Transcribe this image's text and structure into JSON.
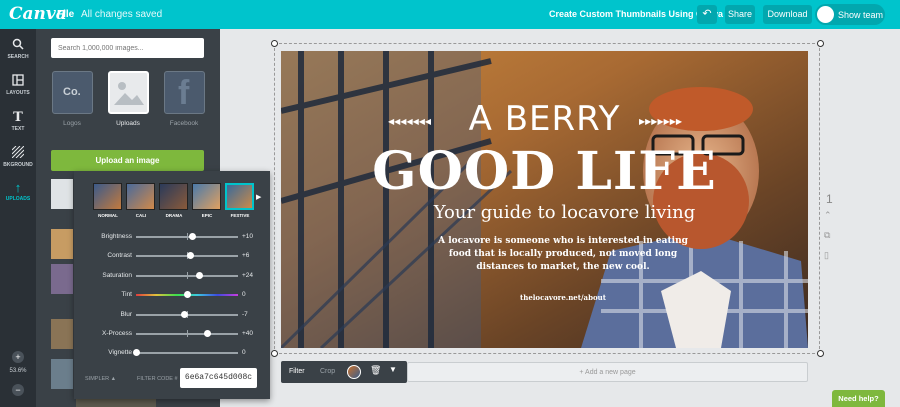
{
  "topbar": {
    "logo": "Canva",
    "file_menu": "File",
    "save_status": "All changes saved",
    "document_title": "Create Custom Thumbnails Using Canva",
    "undo_icon": "undo-icon",
    "share_label": "Share",
    "download_label": "Download",
    "team_label": "Show team"
  },
  "rail": {
    "items": [
      {
        "label": "SEARCH",
        "icon": "search-icon"
      },
      {
        "label": "LAYOUTS",
        "icon": "layouts-icon"
      },
      {
        "label": "TEXT",
        "icon": "text-icon"
      },
      {
        "label": "BKGROUND",
        "icon": "background-icon"
      },
      {
        "label": "UPLOADS",
        "icon": "upload-icon"
      }
    ],
    "zoom_in": "+",
    "zoom_level": "53.6%",
    "zoom_out": "−"
  },
  "panel": {
    "search_placeholder": "Search 1,000,000 images...",
    "sources": [
      {
        "label": "Logos",
        "tile_text": "Co."
      },
      {
        "label": "Uploads",
        "tile_text": ""
      },
      {
        "label": "Facebook",
        "tile_text": "f"
      }
    ],
    "upload_button": "Upload an image"
  },
  "filter_panel": {
    "presets": [
      "NORMAL",
      "CALI",
      "DRAMA",
      "EPIC",
      "FESTIVE"
    ],
    "selected_preset": "FESTIVE",
    "sliders": [
      {
        "label": "Brightness",
        "value": "+10",
        "pos": 0.55
      },
      {
        "label": "Contrast",
        "value": "+6",
        "pos": 0.53
      },
      {
        "label": "Saturation",
        "value": "+24",
        "pos": 0.62
      },
      {
        "label": "Tint",
        "value": "0",
        "pos": 0.5
      },
      {
        "label": "Blur",
        "value": "-7",
        "pos": 0.47
      },
      {
        "label": "X-Process",
        "value": "+40",
        "pos": 0.7
      },
      {
        "label": "Vignette",
        "value": "0",
        "pos": 0.0
      }
    ],
    "simpler_label": "SIMPLER ▲",
    "filter_code_label": "FILTER CODE #",
    "filter_code": "6e6a7c645d008c"
  },
  "design": {
    "headline_small": "A BERRY",
    "headline_big": "GOOD LIFE",
    "subhead": "Your guide to locavore living",
    "body": "A locavore is someone who is interested in eating food that is locally produced, not moved long distances to market, the new cool.",
    "url": "thelocavore.net/about"
  },
  "canvas": {
    "page_number": "1",
    "add_page": "+ Add a new page"
  },
  "toolbar": {
    "filter_label": "Filter",
    "crop_label": "Crop"
  },
  "help": {
    "label": "Need help?"
  },
  "colors": {
    "brand": "#00c4cc",
    "action_green": "#7eb83d",
    "dark_panel": "#3a4147"
  }
}
